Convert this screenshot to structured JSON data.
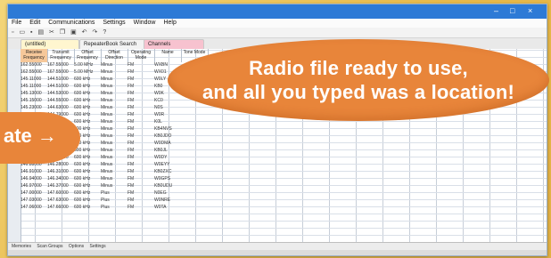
{
  "window": {
    "controls": {
      "minimize": "–",
      "maximize": "□",
      "close": "×"
    }
  },
  "menubar": [
    "File",
    "Edit",
    "Communications",
    "Settings",
    "Window",
    "Help"
  ],
  "tabs": [
    {
      "label": "(untitled)"
    },
    {
      "label": "RepeaterBook Search"
    },
    {
      "label": "Channels"
    }
  ],
  "grid": {
    "headers": [
      "",
      "Receive Frequency",
      "Transmit Frequency",
      "Offset Frequency",
      "Offset Direction",
      "Operating Mode",
      "Name",
      "Tone Mode"
    ],
    "rows": [
      [
        "1",
        "162.55000",
        "167.55000",
        "5.00 MHz",
        "Minus",
        "FM",
        "WXBN"
      ],
      [
        "2",
        "162.55000",
        "167.55000",
        "5.00 MHz",
        "Minus",
        "FM",
        "WX01"
      ],
      [
        "3",
        "145.11000",
        "144.51000",
        "600 kHz",
        "Minus",
        "FM",
        "W0LY"
      ],
      [
        "4",
        "145.11000",
        "144.51000",
        "600 kHz",
        "Minus",
        "FM",
        "KB0"
      ],
      [
        "5",
        "145.13000",
        "144.53000",
        "600 kHz",
        "Minus",
        "FM",
        "W0K"
      ],
      [
        "6",
        "145.15000",
        "144.55000",
        "600 kHz",
        "Minus",
        "FM",
        "KC0"
      ],
      [
        "7",
        "145.23000",
        "144.63000",
        "600 kHz",
        "Minus",
        "FM",
        "N0S"
      ],
      [
        "8",
        "145.39000",
        "144.79000",
        "600 kHz",
        "Minus",
        "FM",
        "W0R"
      ],
      [
        "9",
        "145.41000",
        "144.81000",
        "600 kHz",
        "Minus",
        "FM",
        "K0L"
      ],
      [
        "10",
        "146.73000",
        "146.13000",
        "600 kHz",
        "Minus",
        "FM",
        "KB4NVS"
      ],
      [
        "11",
        "146.76000",
        "146.16000",
        "600 kHz",
        "Minus",
        "FM",
        "KB0JDO"
      ],
      [
        "12",
        "146.79000",
        "146.19000",
        "600 kHz",
        "Minus",
        "FM",
        "W0DMA"
      ],
      [
        "13",
        "146.82000",
        "146.22000",
        "600 kHz",
        "Minus",
        "FM",
        "KB0JL"
      ],
      [
        "14",
        "146.85000",
        "146.25000",
        "600 kHz",
        "Minus",
        "FM",
        "W0DY"
      ],
      [
        "15",
        "146.88000",
        "146.28000",
        "600 kHz",
        "Minus",
        "FM",
        "W0EYY"
      ],
      [
        "16",
        "146.91000",
        "146.31000",
        "600 kHz",
        "Minus",
        "FM",
        "KB0ZXC"
      ],
      [
        "17",
        "146.94000",
        "146.34000",
        "600 kHz",
        "Minus",
        "FM",
        "W0GPS"
      ],
      [
        "18",
        "146.97000",
        "146.37000",
        "600 kHz",
        "Minus",
        "FM",
        "KB0UDU"
      ],
      [
        "19",
        "147.00000",
        "147.60000",
        "600 kHz",
        "Plus",
        "FM",
        "N0EG"
      ],
      [
        "20",
        "147.03000",
        "147.63000",
        "600 kHz",
        "Plus",
        "FM",
        "W0NRE"
      ],
      [
        "21",
        "147.06000",
        "147.66000",
        "600 kHz",
        "Plus",
        "FM",
        "W0TA"
      ]
    ]
  },
  "callout": {
    "line1": "Radio file ready to use,",
    "line2": "and all you typed was a location!"
  },
  "side_arrow": {
    "text": "ate →"
  },
  "sheet_tabs": [
    "Memories",
    "Scan Groups",
    "Options",
    "Settings"
  ]
}
